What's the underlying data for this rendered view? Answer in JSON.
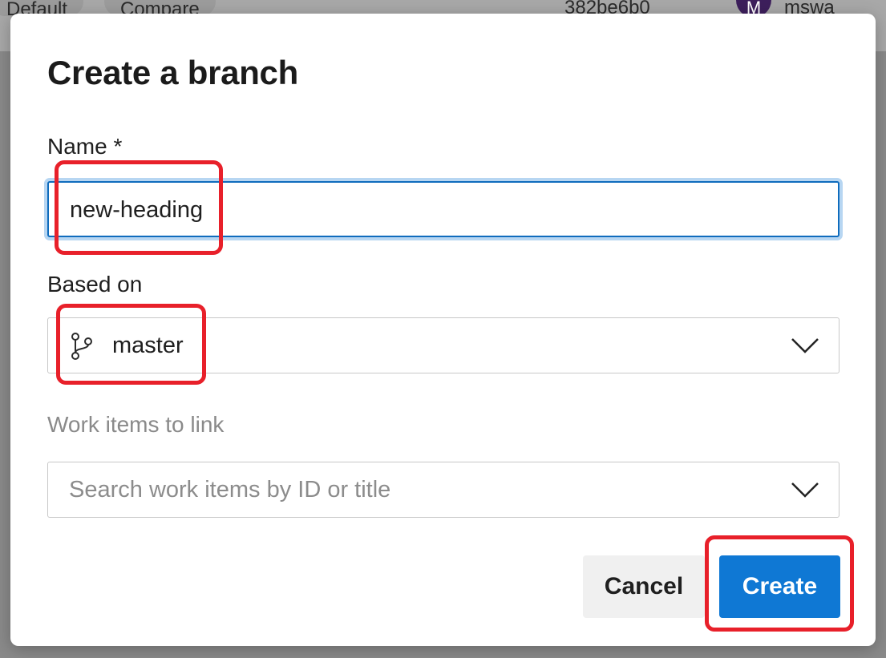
{
  "background": {
    "tab_default": "Default",
    "tab_compare": "Compare",
    "commit_id": "382be6b0",
    "avatar_letter": "M",
    "user_name": "mswa"
  },
  "dialog": {
    "title": "Create a branch",
    "name_label": "Name *",
    "name_value": "new-heading",
    "based_on_label": "Based on",
    "based_on_value": "master",
    "work_items_label": "Work items to link",
    "work_items_placeholder": "Search work items by ID or title",
    "cancel_label": "Cancel",
    "create_label": "Create"
  },
  "icons": {
    "branch": "git-branch-icon",
    "chevron": "chevron-down-icon"
  },
  "colors": {
    "primary": "#0f78d4",
    "focus_border": "#0f6cbd",
    "annotation": "#e8202a"
  }
}
